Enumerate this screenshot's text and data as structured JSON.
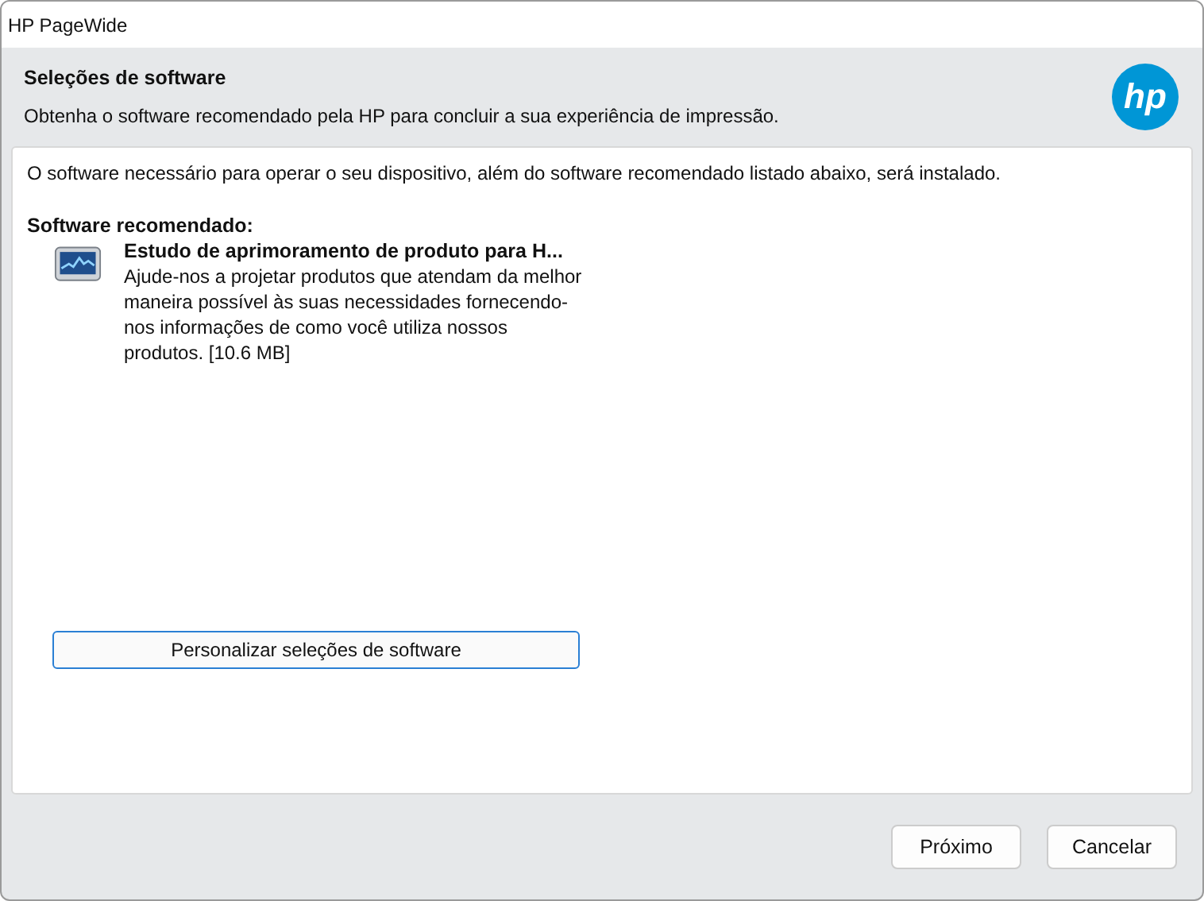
{
  "window": {
    "title": "HP PageWide"
  },
  "header": {
    "title": "Seleções de software",
    "subtitle": "Obtenha o software recomendado pela HP para concluir a sua experiência de impressão.",
    "logo": "hp"
  },
  "content": {
    "intro": "O software necessário para operar o seu dispositivo, além do software recomendado listado abaixo, será instalado.",
    "section_title": "Software recomendado:",
    "items": [
      {
        "title": "Estudo de aprimoramento de produto para H...",
        "description": "Ajude-nos a projetar produtos que atendam da melhor maneira possível às suas necessidades fornecendo-nos informações de como você utiliza nossos produtos. [10.6 MB]"
      }
    ],
    "customize_button": "Personalizar seleções de software"
  },
  "buttons": [
    "Próximo",
    "Cancelar"
  ]
}
